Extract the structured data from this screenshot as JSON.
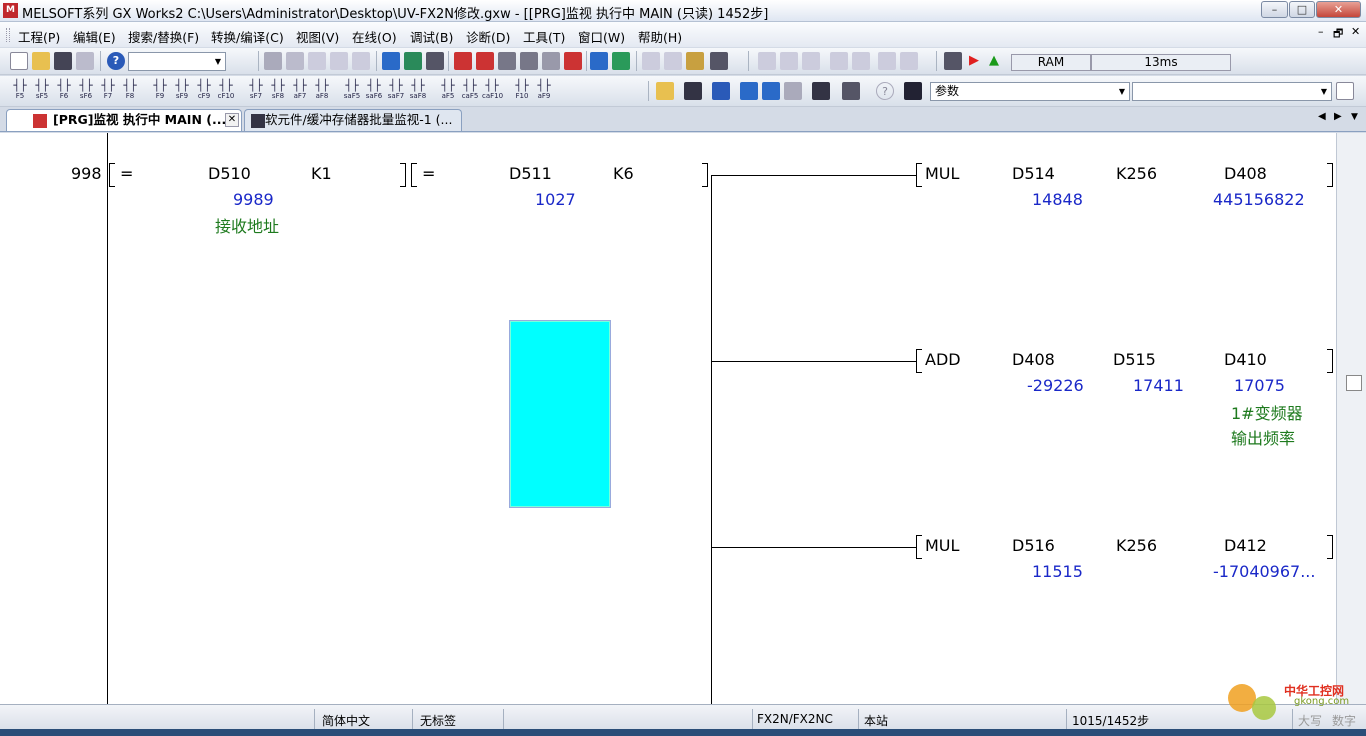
{
  "window": {
    "title": "MELSOFT系列 GX Works2 C:\\Users\\Administrator\\Desktop\\UV-FX2N修改.gxw - [[PRG]监视 执行中 MAIN (只读) 1452步]",
    "app_icon": "melsoft-app-icon",
    "controls": [
      "–",
      "□",
      "✕"
    ]
  },
  "menu": {
    "items": [
      "工程(P)",
      "编辑(E)",
      "搜索/替换(F)",
      "转换/编译(C)",
      "视图(V)",
      "在线(O)",
      "调试(B)",
      "诊断(D)",
      "工具(T)",
      "窗口(W)",
      "帮助(H)"
    ],
    "mdi_controls": [
      "–",
      "🗗",
      "✕"
    ]
  },
  "toolbar1": {
    "plc_status": "RAM",
    "scan_time": "13ms",
    "run_icon_color": "#e02020",
    "stop_icon_color": "#1a9a1a"
  },
  "toolbar2": {
    "fkeys": [
      "F5",
      "sF5",
      "F6",
      "sF6",
      "F7",
      "F8",
      "F9",
      "sF9",
      "cF9",
      "cF10",
      "sF7",
      "sF8",
      "aF7",
      "aF8",
      "saF5",
      "saF6",
      "saF7",
      "saF8",
      "aF5",
      "caF5",
      "caF10",
      "F10",
      "aF9"
    ],
    "param_combo": "参数",
    "empty_combo": ""
  },
  "tabs": [
    {
      "label": "[PRG]监视 执行中 MAIN (...",
      "active": true
    },
    {
      "label": "软元件/缓冲存储器批量监视-1 (...",
      "active": false
    }
  ],
  "ladder": {
    "step": "998",
    "contact1": {
      "op": "=",
      "s1": "D510",
      "s2": "K1",
      "s1_value": "9989",
      "s1_comment": "接收地址"
    },
    "contact2": {
      "op": "=",
      "s1": "D511",
      "s2": "K6",
      "s1_value": "1027"
    },
    "instr1": {
      "op": "MUL",
      "a": "D514",
      "b": "K256",
      "d": "D408",
      "a_value": "14848",
      "d_value": "445156822"
    },
    "instr2": {
      "op": "ADD",
      "a": "D408",
      "b": "D515",
      "d": "D410",
      "a_value": "-29226",
      "b_value": "17411",
      "d_value": "17075",
      "d_comment1": "1#变频器",
      "d_comment2": "输出频率"
    },
    "instr3": {
      "op": "MUL",
      "a": "D516",
      "b": "K256",
      "d": "D412",
      "a_value": "11515",
      "d_value": "-17040967..."
    }
  },
  "statusbar": {
    "language": "简体中文",
    "label": "无标签",
    "plc_type": "FX2N/FX2NC",
    "station": "本站",
    "steps": "1015/1452步",
    "caps": "大写",
    "num": "数字"
  },
  "watermark": {
    "text1": "中华工控网",
    "text2": "gkong.com"
  },
  "colors": {
    "value_blue": "#1a28c8",
    "comment_green": "#1e7a1e",
    "cursor_cyan": "#00ffff"
  }
}
